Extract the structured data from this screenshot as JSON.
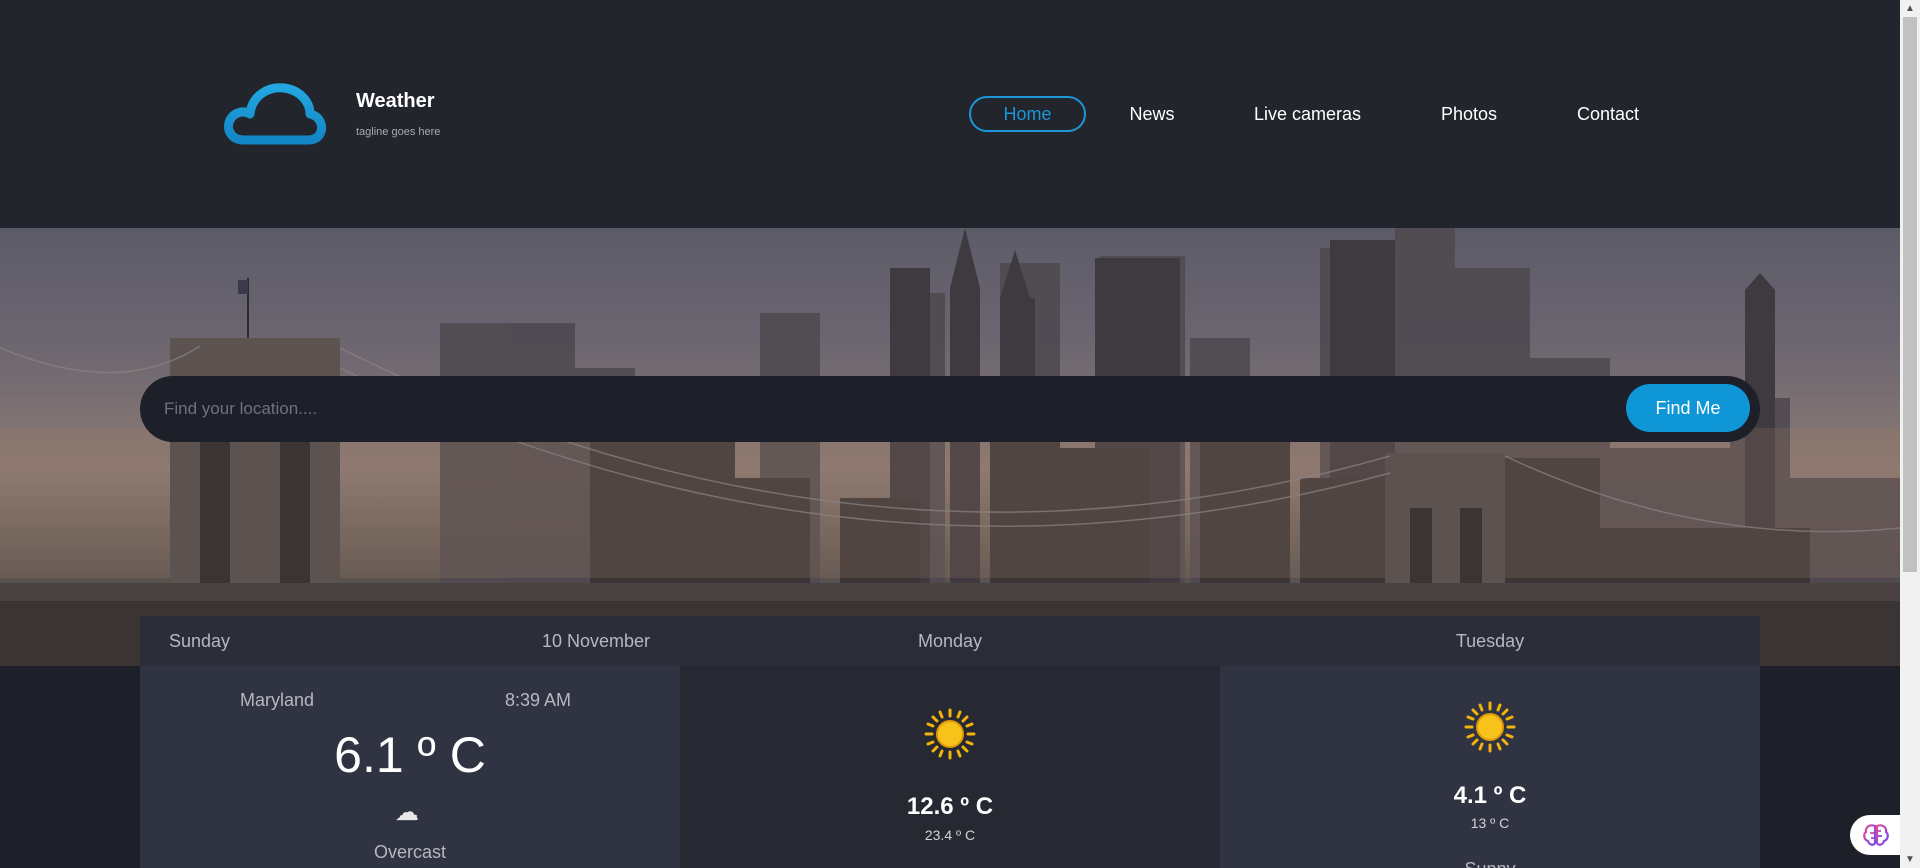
{
  "header": {
    "brand_title": "Weather",
    "brand_tagline": "tagline goes here",
    "logo_icon": "cloud-icon",
    "nav": {
      "home": "Home",
      "news": "News",
      "live_cameras": "Live cameras",
      "photos": "Photos",
      "contact": "Contact"
    },
    "active_nav": "Home"
  },
  "search": {
    "placeholder": "Find your location....",
    "button_label": "Find Me"
  },
  "forecast": {
    "today": {
      "day": "Sunday",
      "date": "10  November",
      "location": "Maryland",
      "time": "8:39 AM",
      "temperature": "6.1 º C",
      "icon": "cloud-icon",
      "condition": "Overcast"
    },
    "days": [
      {
        "day": "Monday",
        "icon": "sun-icon",
        "high": "12.6 º C",
        "low": "23.4 º C"
      },
      {
        "day": "Tuesday",
        "icon": "sun-icon",
        "high": "4.1 º C",
        "low": "13 º C",
        "condition": "Sunny"
      }
    ]
  },
  "colors": {
    "accent": "#0f96d6",
    "header_bg": "#22252c",
    "search_bg": "#1d1f29",
    "sun": "#f4b30c"
  }
}
